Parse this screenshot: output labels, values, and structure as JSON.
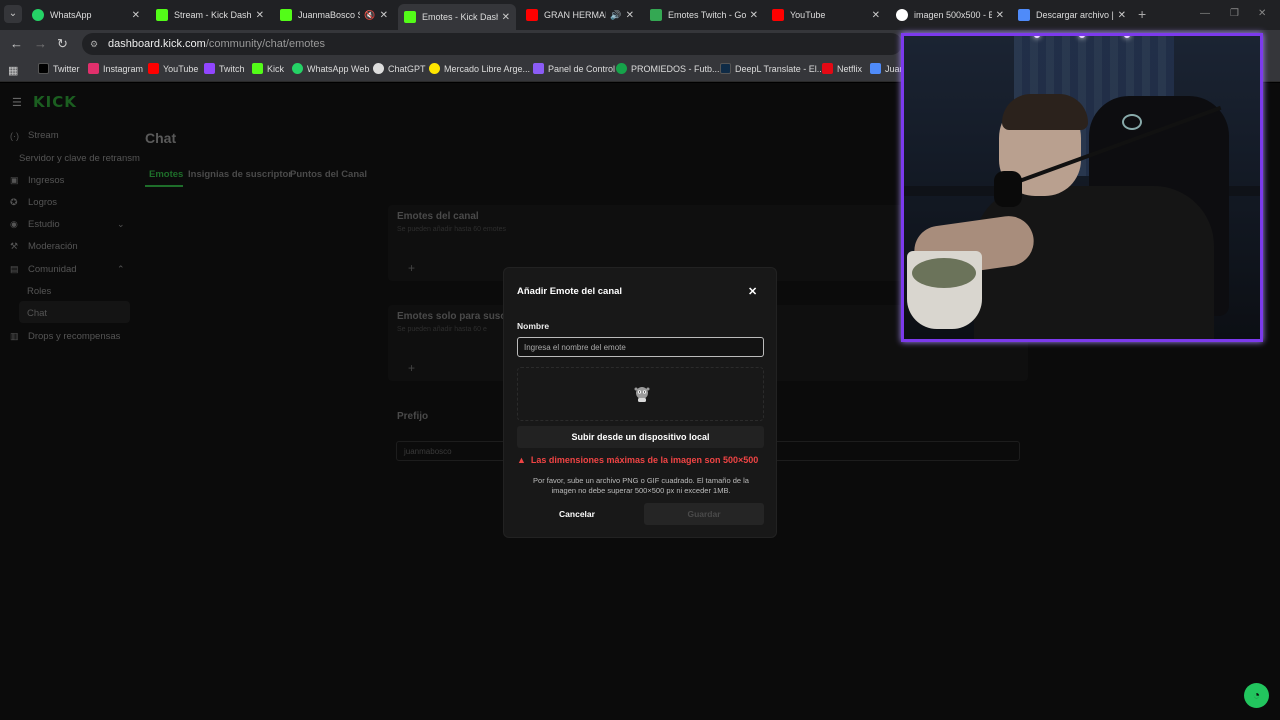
{
  "browser": {
    "tabs": [
      {
        "title": "WhatsApp",
        "color": "#25d366"
      },
      {
        "title": "Stream - Kick Dashbo",
        "color": "#53fc18"
      },
      {
        "title": "JuanmaBosco Str",
        "color": "#53fc18"
      },
      {
        "title": "Emotes - Kick Dashbo",
        "color": "#53fc18"
      },
      {
        "title": "GRAN HERMANO",
        "color": "#ff0000"
      },
      {
        "title": "Emotes Twitch - Goo",
        "color": "#34a853"
      },
      {
        "title": "YouTube",
        "color": "#ff0000"
      },
      {
        "title": "imagen 500x500 - Bu",
        "color": "#ffffff"
      },
      {
        "title": "Descargar archivo | li",
        "color": "#4f8bf9"
      }
    ],
    "url_host": "dashboard.kick.com",
    "url_path": "/community/chat/emotes",
    "bookmarks": [
      {
        "label": "Twitter",
        "color": "#000000"
      },
      {
        "label": "Instagram",
        "color": "#e1306c"
      },
      {
        "label": "YouTube",
        "color": "#ff0000"
      },
      {
        "label": "Twitch",
        "color": "#9146ff"
      },
      {
        "label": "Kick",
        "color": "#53fc18"
      },
      {
        "label": "WhatsApp Web",
        "color": "#25d366"
      },
      {
        "label": "ChatGPT",
        "color": "#dddddd"
      },
      {
        "label": "Mercado Libre Arge...",
        "color": "#ffe600"
      },
      {
        "label": "Panel de Control",
        "color": "#8b5cf6"
      },
      {
        "label": "PROMIEDOS - Futb...",
        "color": "#16a34a"
      },
      {
        "label": "DeepL Translate - El...",
        "color": "#0f2b46"
      },
      {
        "label": "Netflix",
        "color": "#e50914"
      },
      {
        "label": "Juan",
        "color": "#4f8bf9"
      }
    ]
  },
  "app": {
    "logo": "KICK",
    "sidebar": {
      "stream": "Stream",
      "stream_key": "Servidor y clave de retransm",
      "ingresos": "Ingresos",
      "logros": "Logros",
      "estudio": "Estudio",
      "moderacion": "Moderación",
      "comunidad": "Comunidad",
      "roles": "Roles",
      "chat": "Chat",
      "drops": "Drops y recompensas"
    },
    "page_title": "Chat",
    "tabs": [
      "Emotes",
      "Insignias de suscriptor",
      "Puntos del Canal"
    ],
    "channel_emotes": {
      "title": "Emotes del canal",
      "subtitle": "Se pueden añadir hasta 60 emotes"
    },
    "sub_emotes": {
      "title": "Emotes solo para suscr",
      "subtitle": "Se pueden añadir hasta 60 e"
    },
    "prefix": {
      "title": "Prefijo",
      "value": "juanmabosco"
    }
  },
  "modal": {
    "title": "Añadir Emote del canal",
    "name_label": "Nombre",
    "name_placeholder": "Ingresa el nombre del emote",
    "upload_label": "Subir desde un dispositivo local",
    "warning": "Las dimensiones máximas de la imagen son 500×500",
    "help": "Por favor, sube un archivo PNG o GIF cuadrado. El tamaño de la imagen no debe superar 500×500 px ni exceder 1MB.",
    "cancel_label": "Cancelar",
    "save_label": "Guardar"
  },
  "colors": {
    "kick_green": "#53fc18",
    "warning_red": "#ef4444",
    "cam_border": "#7c3aed"
  }
}
